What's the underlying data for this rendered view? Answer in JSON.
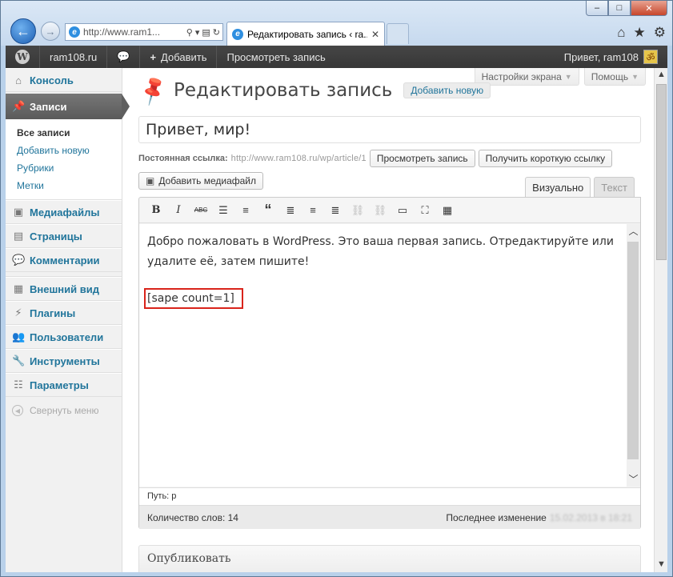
{
  "browser": {
    "address_url": "http://www.ram1...",
    "tab_title": "Редактировать запись ‹ ra...",
    "window_buttons": {
      "minimize": "–",
      "maximize": "□",
      "close": "✕"
    },
    "icons": [
      "back-arrow-icon",
      "forward-arrow-icon",
      "ie-icon",
      "search-icon",
      "refresh-icon",
      "home-icon",
      "star-icon",
      "gear-icon"
    ]
  },
  "adminbar": {
    "site_name": "ram108.ru",
    "comments_icon": "speech-bubble-icon",
    "add_label": "Добавить",
    "view_post": "Просмотреть запись",
    "greeting": "Привет, ram108",
    "avatar_glyph": "ॐ"
  },
  "sidebar": {
    "items": [
      {
        "label": "Консоль",
        "icon": "dashboard-icon"
      },
      {
        "label": "Записи",
        "icon": "pin-icon"
      },
      {
        "label": "Медиафайлы",
        "icon": "media-icon"
      },
      {
        "label": "Страницы",
        "icon": "pages-icon"
      },
      {
        "label": "Комментарии",
        "icon": "comments-icon"
      },
      {
        "label": "Внешний вид",
        "icon": "appearance-icon"
      },
      {
        "label": "Плагины",
        "icon": "plugins-icon"
      },
      {
        "label": "Пользователи",
        "icon": "users-icon"
      },
      {
        "label": "Инструменты",
        "icon": "tools-icon"
      },
      {
        "label": "Параметры",
        "icon": "settings-icon"
      }
    ],
    "submenu": [
      "Все записи",
      "Добавить новую",
      "Рубрики",
      "Метки"
    ],
    "collapse_label": "Свернуть меню"
  },
  "header": {
    "screen_options": "Настройки экрана",
    "help": "Помощь",
    "page_title": "Редактировать запись",
    "add_new": "Добавить новую"
  },
  "post": {
    "title": "Привет, мир!",
    "permalink_label": "Постоянная ссылка:",
    "permalink_url": "http://www.ram108.ru/wp/article/1",
    "view_post_button": "Просмотреть запись",
    "shortlink_button": "Получить короткую ссылку",
    "add_media_button": "Добавить медиафайл"
  },
  "editor": {
    "tab_visual": "Визуально",
    "tab_text": "Текст",
    "content_paragraph": "Добро пожаловать в WordPress. Это ваша первая запись. Отредактируйте или удалите её, затем пишите!",
    "shortcode": "[sape count=1]",
    "path": "Путь: p",
    "word_count": "Количество слов: 14",
    "last_edited_label": "Последнее изменение",
    "last_edited_value": "15.02.2013 в 18:21"
  },
  "publish_box": {
    "title": "Опубликовать"
  }
}
